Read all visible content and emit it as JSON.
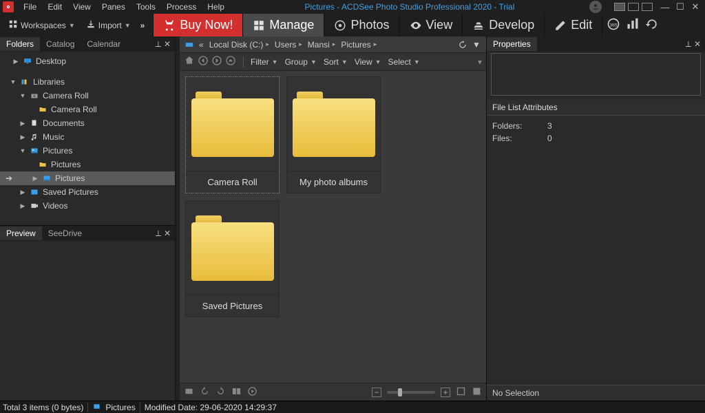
{
  "title": "Pictures - ACDSee Photo Studio Professional 2020 - Trial",
  "menus": [
    "File",
    "Edit",
    "View",
    "Panes",
    "Tools",
    "Process",
    "Help"
  ],
  "toolbar": {
    "workspaces": "Workspaces",
    "import": "Import"
  },
  "modes": {
    "buy": "Buy Now!",
    "manage": "Manage",
    "photos": "Photos",
    "view": "View",
    "develop": "Develop",
    "edit": "Edit"
  },
  "left_tabs": {
    "folders": "Folders",
    "catalog": "Catalog",
    "calendar": "Calendar"
  },
  "tree": {
    "desktop": "Desktop",
    "libraries": "Libraries",
    "camera_roll": "Camera Roll",
    "camera_roll_child": "Camera Roll",
    "documents": "Documents",
    "music": "Music",
    "pictures": "Pictures",
    "pictures_child": "Pictures",
    "pictures_selected": "Pictures",
    "saved_pictures": "Saved Pictures",
    "videos": "Videos"
  },
  "preview_tabs": {
    "preview": "Preview",
    "seedrive": "SeeDrive"
  },
  "breadcrumb": {
    "drive": "Local Disk (C:)",
    "users": "Users",
    "user": "Mansi",
    "folder": "Pictures"
  },
  "filters": {
    "filter": "Filter",
    "group": "Group",
    "sort": "Sort",
    "view": "View",
    "select": "Select"
  },
  "thumbs": [
    "Camera Roll",
    "My photo albums",
    "Saved Pictures"
  ],
  "right": {
    "properties": "Properties",
    "section": "File List Attributes",
    "folders_label": "Folders:",
    "folders_val": "3",
    "files_label": "Files:",
    "files_val": "0",
    "no_selection": "No Selection"
  },
  "status": {
    "total": "Total 3 items  (0 bytes)",
    "loc": "Pictures",
    "modified": "Modified Date: 29-06-2020 14:29:37"
  }
}
